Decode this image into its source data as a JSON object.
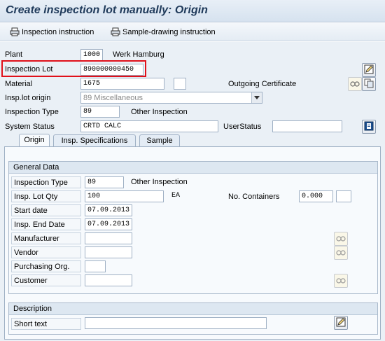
{
  "window": {
    "title": "Create inspection lot manually: Origin"
  },
  "toolbar": {
    "inspection_instruction": "Inspection instruction",
    "sample_drawing_instruction": "Sample-drawing instruction"
  },
  "header": {
    "plant": {
      "label": "Plant",
      "value": "1000",
      "text": "Werk Hamburg"
    },
    "inspection_lot": {
      "label": "Inspection Lot",
      "value": "890000000450"
    },
    "material": {
      "label": "Material",
      "value": "1675",
      "outgoing_certificate_label": "Outgoing Certificate"
    },
    "insp_lot_origin": {
      "label": "Insp.lot origin",
      "value": "89 Miscellaneous"
    },
    "inspection_type": {
      "label": "Inspection Type",
      "value": "89",
      "text": "Other Inspection"
    },
    "system_status": {
      "label": "System Status",
      "value": "CRTD CALC",
      "user_status_label": "UserStatus"
    }
  },
  "tabs": [
    {
      "label": "Origin",
      "active": true
    },
    {
      "label": "Insp. Specifications",
      "active": false
    },
    {
      "label": "Sample",
      "active": false
    }
  ],
  "general_data": {
    "title": "General Data",
    "inspection_type": {
      "label": "Inspection Type",
      "value": "89",
      "text": "Other Inspection"
    },
    "insp_lot_qty": {
      "label": "Insp. Lot Qty",
      "value": "100",
      "unit": "EA"
    },
    "no_containers": {
      "label": "No. Containers",
      "value": "0.000"
    },
    "start_date": {
      "label": "Start date",
      "value": "07.09.2013"
    },
    "insp_end_date": {
      "label": "Insp. End Date",
      "value": "07.09.2013"
    },
    "manufacturer": {
      "label": "Manufacturer"
    },
    "vendor": {
      "label": "Vendor"
    },
    "purchasing_org": {
      "label": "Purchasing Org."
    },
    "customer": {
      "label": "Customer"
    }
  },
  "description": {
    "title": "Description",
    "short_text": {
      "label": "Short text"
    }
  },
  "colors": {
    "highlight": "#e0101a",
    "title_text": "#1f3a5a"
  }
}
